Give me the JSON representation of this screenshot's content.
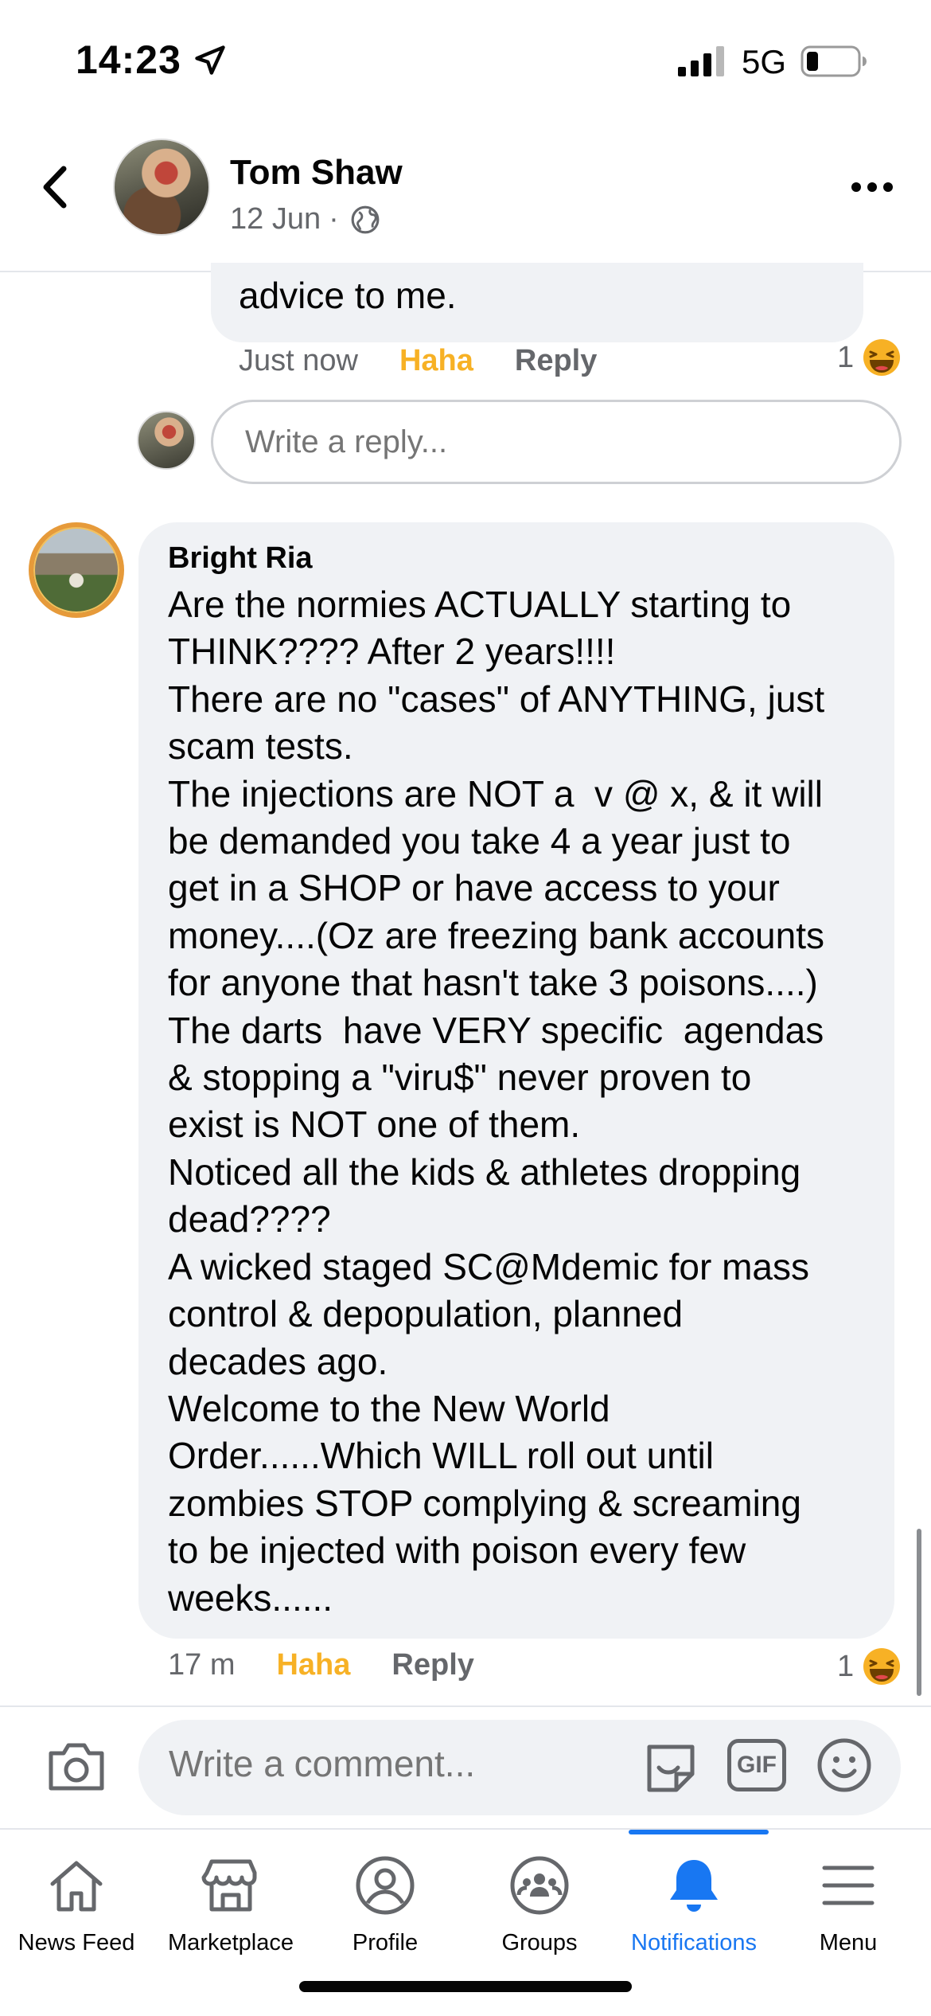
{
  "status_bar": {
    "time": "14:23",
    "network": "5G",
    "icons": [
      "location-arrow-icon",
      "signal-bars-icon",
      "battery-icon"
    ]
  },
  "post_header": {
    "author": "Tom Shaw",
    "date": "12 Jun",
    "separator": "·",
    "audience_icon": "globe-icon",
    "more_icon": "more-dots-icon"
  },
  "previous_comment": {
    "text_tail": "advice to me.",
    "time": "Just now",
    "reaction_label": "Haha",
    "reply_label": "Reply",
    "reaction_count": "1"
  },
  "reply_box": {
    "placeholder": "Write a reply..."
  },
  "comment": {
    "author": "Bright Ria",
    "lines": [
      "Are the normies ACTUALLY starting to",
      "THINK???? After 2 years!!!!",
      "There are no \"cases\" of ANYTHING, just",
      "scam tests.",
      "The injections are NOT a  v @ x, & it will",
      "be demanded you take 4 a year just to",
      "get in a SHOP or have access to your",
      "money....(Oz are freezing bank accounts",
      "for anyone that hasn't take 3 poisons....)",
      "The darts  have VERY specific  agendas",
      "& stopping a \"viru$\" never proven to",
      "exist is NOT one of them.",
      "Noticed all the kids & athletes dropping",
      "dead????",
      "A wicked staged SC@Mdemic for mass",
      "control & depopulation, planned",
      "decades ago.",
      "Welcome to the New World",
      "Order......Which WILL roll out until",
      "zombies STOP complying & screaming",
      "to be injected with poison every few",
      "weeks......"
    ],
    "time": "17 m",
    "reaction_label": "Haha",
    "reply_label": "Reply",
    "reaction_count": "1"
  },
  "composer": {
    "placeholder": "Write a comment...",
    "gif_label": "GIF"
  },
  "nav": {
    "items": [
      {
        "label": "News Feed",
        "icon": "home-icon"
      },
      {
        "label": "Marketplace",
        "icon": "marketplace-icon"
      },
      {
        "label": "Profile",
        "icon": "profile-icon"
      },
      {
        "label": "Groups",
        "icon": "groups-icon"
      },
      {
        "label": "Notifications",
        "icon": "bell-icon",
        "active": true
      },
      {
        "label": "Menu",
        "icon": "menu-icon"
      }
    ]
  },
  "colors": {
    "accent": "#1877f2",
    "haha": "#f7b125",
    "bubble": "#f0f2f5",
    "secondary_text": "#65676b"
  }
}
